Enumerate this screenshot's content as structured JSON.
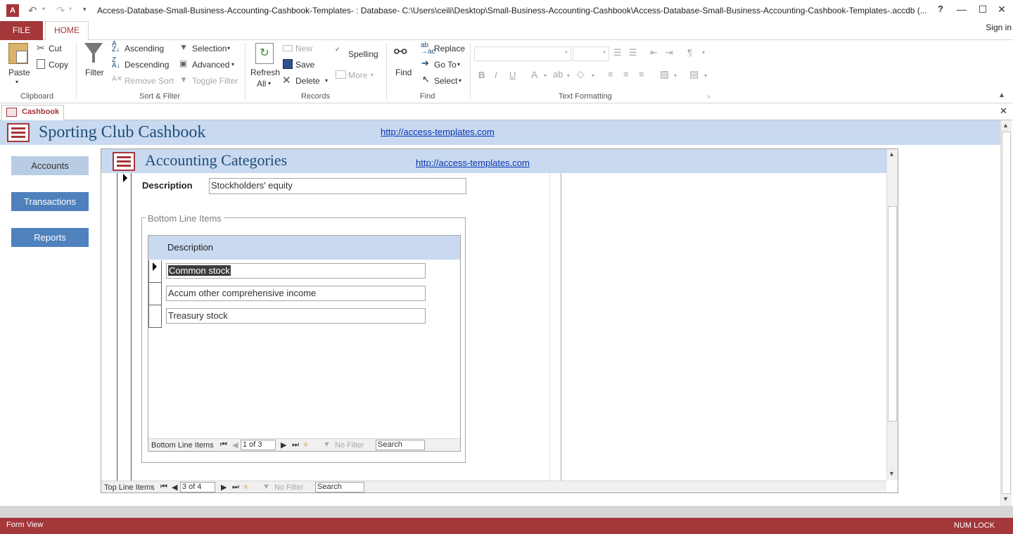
{
  "window": {
    "title": "Access-Database-Small-Business-Accounting-Cashbook-Templates- : Database- C:\\Users\\ceili\\Desktop\\Small-Business-Accounting-Cashbook\\Access-Database-Small-Business-Accounting-Cashbook-Templates-.accdb (...",
    "help": "?",
    "minimize": "—",
    "restore": "☐",
    "close": "✕"
  },
  "ribbon_tabs": {
    "file": "FILE",
    "home": "HOME",
    "signin": "Sign in"
  },
  "ribbon": {
    "clipboard": {
      "paste": "Paste",
      "cut": "Cut",
      "copy": "Copy",
      "label": "Clipboard"
    },
    "sort_filter": {
      "filter": "Filter",
      "ascending": "Ascending",
      "descending": "Descending",
      "remove_sort": "Remove Sort",
      "selection": "Selection",
      "advanced": "Advanced",
      "toggle_filter": "Toggle Filter",
      "label": "Sort & Filter"
    },
    "records": {
      "refresh": "Refresh",
      "refresh_all": "All",
      "new": "New",
      "save": "Save",
      "delete": "Delete",
      "spelling": "Spelling",
      "more": "More",
      "label": "Records"
    },
    "find": {
      "find": "Find",
      "replace": "Replace",
      "goto": "Go To",
      "select": "Select",
      "label": "Find"
    },
    "text_formatting": {
      "label": "Text Formatting",
      "bold": "B",
      "italic": "I",
      "underline": "U"
    }
  },
  "doc_tab": {
    "label": "Cashbook"
  },
  "main": {
    "title": "Sporting Club Cashbook",
    "link": "http://access-templates.com",
    "nav": [
      "Accounts",
      "Transactions",
      "Reports"
    ]
  },
  "subform": {
    "title": "Accounting Categories",
    "link": "http://access-templates.com",
    "description_label": "Description",
    "description_value": "Stockholders' equity",
    "group_label": "Bottom Line Items",
    "grid_header": "Description",
    "rows": [
      "Common stock",
      "Accum other comprehensive income",
      "Treasury stock"
    ],
    "inner_nav": {
      "label": "Bottom Line Items",
      "record": "1 of 3",
      "filter": "No Filter",
      "search": "Search"
    },
    "outer_nav": {
      "label": "Top Line Items",
      "record": "3 of 4",
      "filter": "No Filter",
      "search": "Search"
    }
  },
  "status": {
    "left": "Form View",
    "right": "NUM LOCK"
  }
}
